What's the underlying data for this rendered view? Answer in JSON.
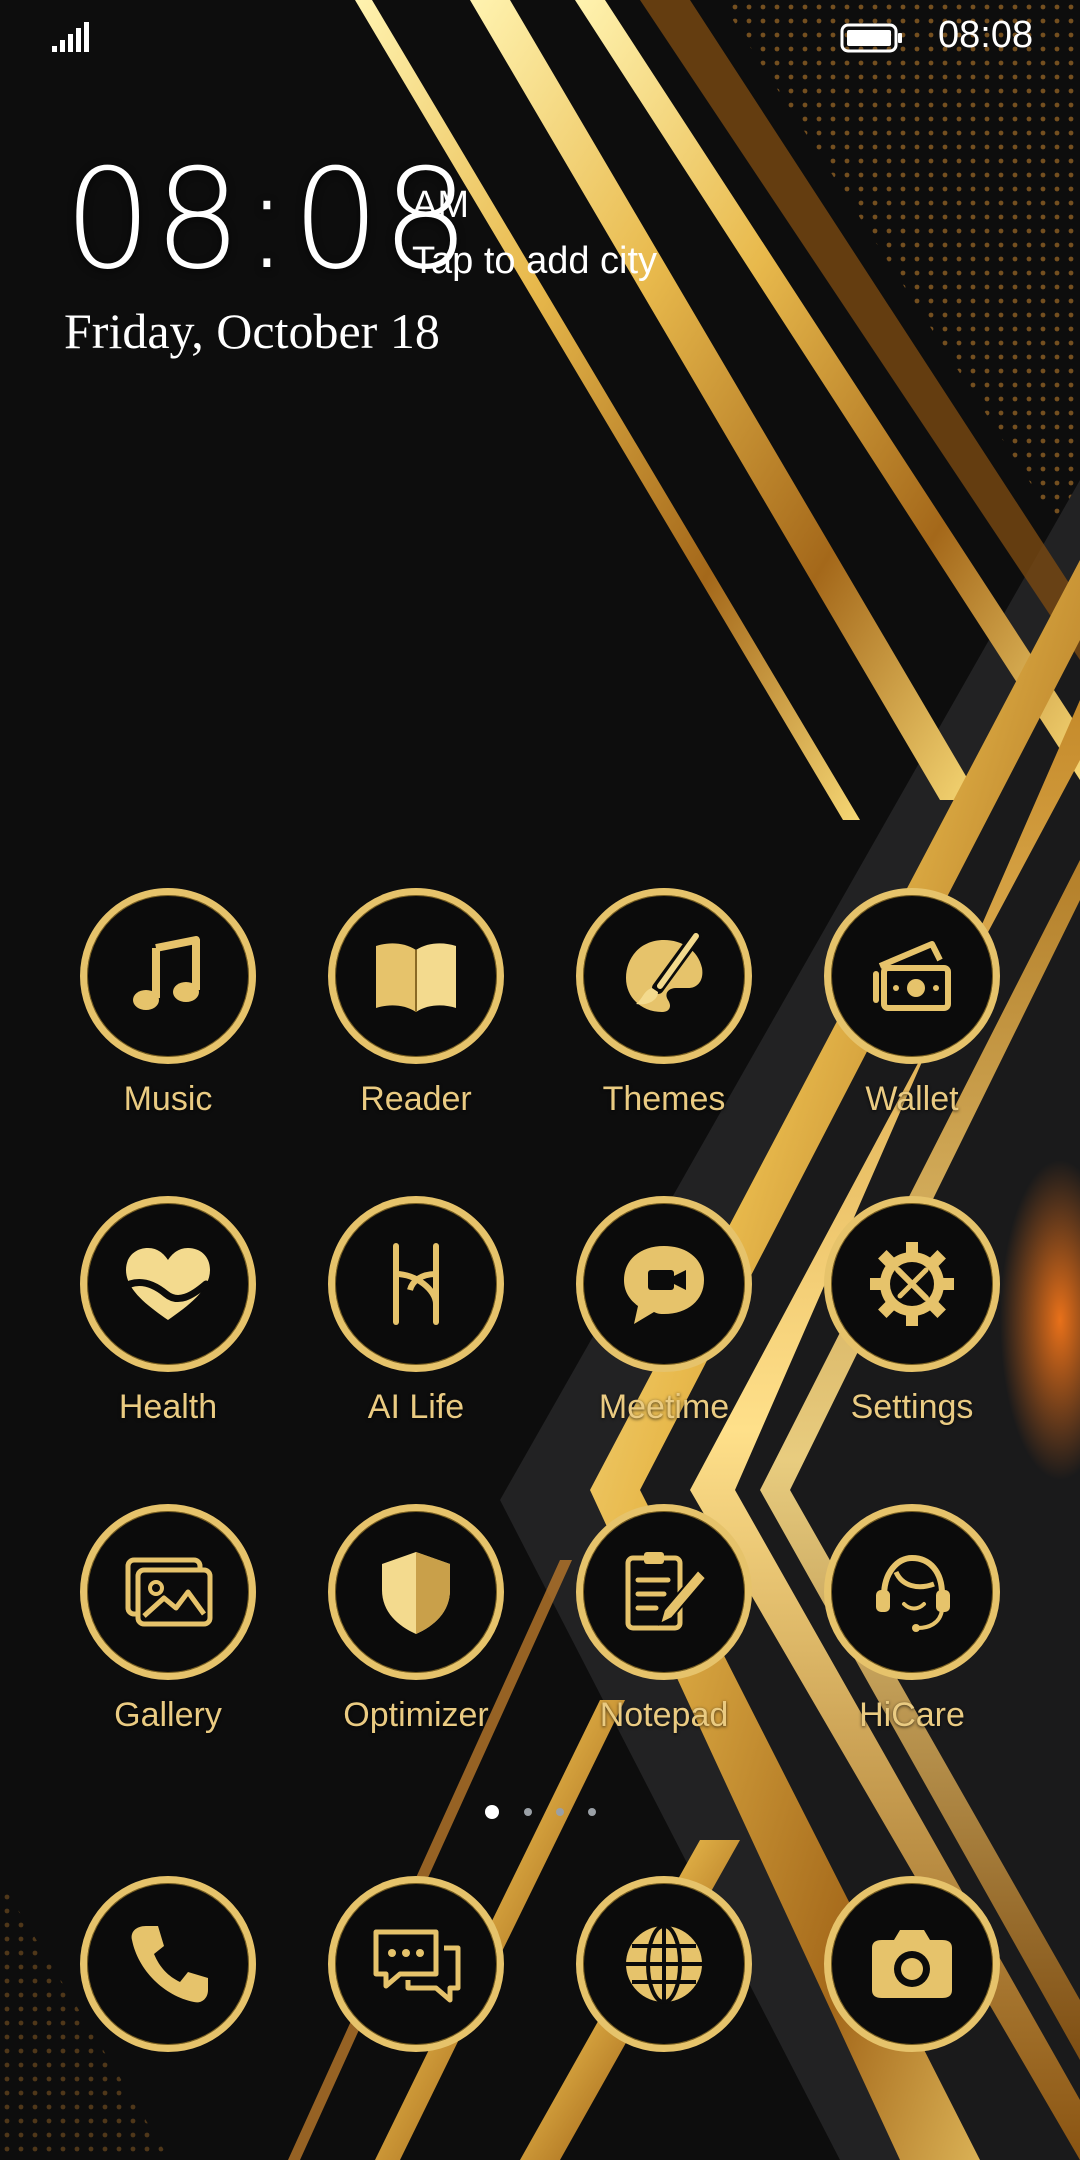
{
  "status_bar": {
    "time": "08:08",
    "signal_icon": "signal-bars-icon",
    "battery_icon": "battery-icon"
  },
  "clock": {
    "time": "08:08",
    "ampm": "AM",
    "city_prompt": "Tap to add city",
    "date": "Friday, October 18"
  },
  "theme": {
    "accent": "#e6c36b",
    "label_color": "#eacb82",
    "background": "#0b0b0b"
  },
  "apps": [
    {
      "label": "Music",
      "icon": "music-note-icon"
    },
    {
      "label": "Reader",
      "icon": "book-icon"
    },
    {
      "label": "Themes",
      "icon": "paintbrush-palette-icon"
    },
    {
      "label": "Wallet",
      "icon": "wallet-icon"
    },
    {
      "label": "Health",
      "icon": "heart-icon"
    },
    {
      "label": "AI Life",
      "icon": "ai-life-icon"
    },
    {
      "label": "Meetime",
      "icon": "video-chat-icon"
    },
    {
      "label": "Settings",
      "icon": "gear-tools-icon"
    },
    {
      "label": "Gallery",
      "icon": "image-icon"
    },
    {
      "label": "Optimizer",
      "icon": "shield-icon"
    },
    {
      "label": "Notepad",
      "icon": "notepad-pencil-icon"
    },
    {
      "label": "HiCare",
      "icon": "headset-icon"
    }
  ],
  "pager": {
    "pages": 4,
    "active": 1
  },
  "dock": [
    {
      "icon": "phone-icon"
    },
    {
      "icon": "messages-icon"
    },
    {
      "icon": "browser-globe-icon"
    },
    {
      "icon": "camera-icon"
    }
  ]
}
